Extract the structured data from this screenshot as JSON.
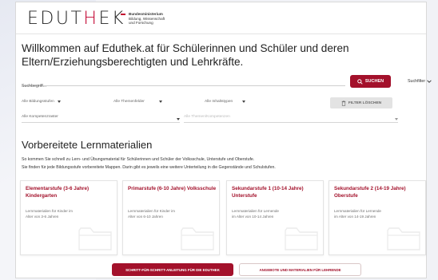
{
  "header": {
    "logo_prefix": "EDUT",
    "logo_accent": "H",
    "logo_suffix": "EK",
    "ministry_line1": "Bundesministerium",
    "ministry_line2": "Bildung, Wissenschaft",
    "ministry_line3": "und Forschung"
  },
  "main": {
    "welcome": "Willkommen auf Eduthek.at für Schülerinnen und Schüler und deren Eltern/Erziehungsberechtigten und Lehrkräfte.",
    "search": {
      "placeholder": "Suchbegriff...",
      "button_label": "SUCHEN",
      "filter_toggle_label": "Suchfilter"
    },
    "filters": {
      "bildungsstufen": "Alle Bildungsstufen",
      "themenfelder": "Alle Themenfelder",
      "inhaltstypen": "Alle Inhaltstypen",
      "kompetenzraster": "Alle Kompetenzraster",
      "themen_kompetenzen": "Alle Themen/Kompetenzen",
      "clear_label": "FILTER LÖSCHEN"
    },
    "section": {
      "title": "Vorbereitete Lernmaterialien",
      "line1": "So kommen Sie schnell zu Lern- und Übungsmaterial für Schülerinnen und Schüler der Volksschule, Unterstufe und Oberstufe.",
      "line2": "Sie finden für jede Bildungsstufe vorbereitete Mappen. Darin gibt es jeweils eine weitere Unterteilung in die Gegenstände und Schulstufen."
    },
    "cards": [
      {
        "title": "Elementarstufe (3-6 Jahre) Kindergarten",
        "desc": "Lernmaterialien für Kinder im Alter von 3-6 Jahren"
      },
      {
        "title": "Primarstufe (6-10 Jahre) Volksschule",
        "desc": "Lernmaterialien für Kinder im Alter von 6-10 Jahren"
      },
      {
        "title": "Sekundarstufe 1 (10-14 Jahre) Unterstufe",
        "desc": "Lernmaterialien für Lernende im Alter von 10-14 Jahren"
      },
      {
        "title": "Sekundarstufe 2 (14-19 Jahre) Oberstufe",
        "desc": "Lernmaterialien für Lernende im Alter von 14-19 Jahren"
      }
    ],
    "cta_primary": "SCHRITT-FÜR-SCHRITT-ANLEITUNG FÜR DIE EDUTHEK",
    "cta_secondary": "ANGEBOTE UND MATERIALIEN FÜR LEHRENDE"
  },
  "colors": {
    "accent": "#a3112b",
    "logo_red": "#c2002f"
  },
  "icons": [
    "search-icon",
    "trash-icon",
    "chevron-down-icon",
    "folder-icon"
  ]
}
